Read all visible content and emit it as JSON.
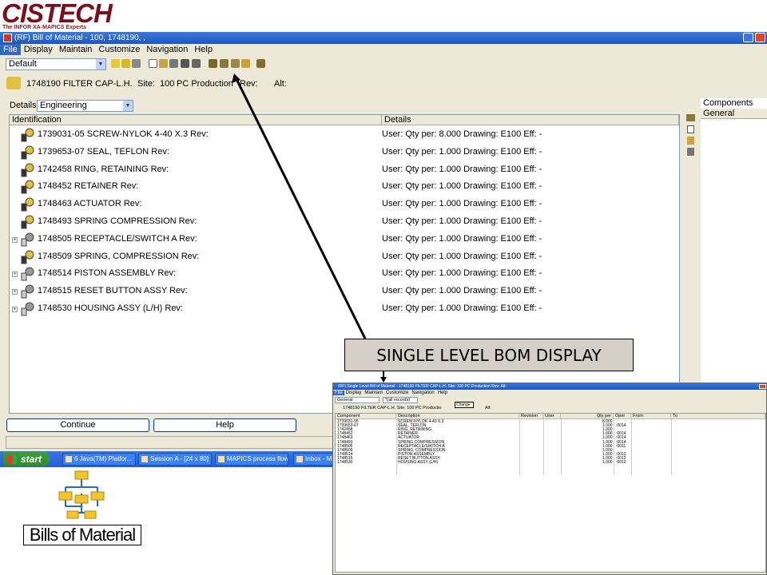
{
  "logo": {
    "text": "CISTECH",
    "tagline": "The INFOR XA-MAPICS Experts"
  },
  "window": {
    "title": "(RF) Bill of Material - 100, 1748190, ,"
  },
  "menu": [
    "File",
    "Display",
    "Maintain",
    "Customize",
    "Navigation",
    "Help"
  ],
  "toolbar": {
    "view": "Default"
  },
  "item": {
    "number": "1748190",
    "description": "FILTER CAP-L.H.",
    "site_label": "Site:",
    "site": "100",
    "site_name": "PC Production",
    "rev_label": "Rev:",
    "alt_label": "Alt:"
  },
  "details": {
    "label": "Details:",
    "value": "Engineering"
  },
  "columns": {
    "identification": "Identification",
    "details": "Details"
  },
  "rows": [
    {
      "id": "1739031-05 SCREW-NYLOK 4-40 X.3   Rev:",
      "det": "User:   Qty per: 8.000   Drawing: E100   Eff: -",
      "expand": false,
      "type": "purchased"
    },
    {
      "id": "1739653-07 SEAL, TEFLON   Rev:",
      "det": "User:   Qty per: 1.000   Drawing: E100   Eff: -",
      "expand": false,
      "type": "purchased"
    },
    {
      "id": "1742458 RING, RETAINING   Rev:",
      "det": "User:   Qty per: 1.000   Drawing: E100   Eff: -",
      "expand": false,
      "type": "purchased"
    },
    {
      "id": "1748452 RETAINER   Rev:",
      "det": "User:   Qty per: 1.000   Drawing: E100   Eff: -",
      "expand": false,
      "type": "purchased"
    },
    {
      "id": "1748463 ACTUATOR   Rev:",
      "det": "User:   Qty per: 1.000   Drawing: E100   Eff: -",
      "expand": false,
      "type": "purchased"
    },
    {
      "id": "1748493 SPRING COMPRESSION   Rev:",
      "det": "User:   Qty per: 1.000   Drawing: E100   Eff: -",
      "expand": false,
      "type": "purchased"
    },
    {
      "id": "1748505 RECEPTACLE/SWITCH A   Rev:",
      "det": "User:   Qty per: 1.000   Drawing: E100   Eff: -",
      "expand": true,
      "type": "assembly"
    },
    {
      "id": "1748509 SPRING, COMPRESSION   Rev:",
      "det": "User:   Qty per: 1.000   Drawing: E100   Eff: -",
      "expand": false,
      "type": "purchased"
    },
    {
      "id": "1748514 PISTON ASSEMBLY   Rev:",
      "det": "User:   Qty per: 1.000   Drawing: E100   Eff: -",
      "expand": true,
      "type": "assembly"
    },
    {
      "id": "1748515 RESET BUTTON ASSY   Rev:",
      "det": "User:   Qty per: 1.000   Drawing: E100   Eff: -",
      "expand": true,
      "type": "assembly"
    },
    {
      "id": "1748530 HOUSING ASSY (L/H)   Rev:",
      "det": "User:   Qty per: 1.000   Drawing: E100   Eff: -",
      "expand": true,
      "type": "assembly"
    }
  ],
  "right_panel": {
    "title": "Components",
    "tab": "General"
  },
  "buttons": {
    "continue": "Continue",
    "help": "Help"
  },
  "taskbar": {
    "start": "start",
    "tasks": [
      "6 Java(TM) Platfor...",
      "Session A - [24 x 80]",
      "MAPICS process flow ...",
      "Inbox - Mic"
    ]
  },
  "bom_logo": {
    "label": "Bills of Material"
  },
  "callout": "SINGLE LEVEL BOM DISPLAY",
  "inset": {
    "title": "(RF) Single Level Bill of Material - 1748190  FILTER CAP-L.H.   Site: 100  PC Production   Rev:   Alt:",
    "menu": [
      "File",
      "Display",
      "Maintain",
      "Customize",
      "Navigation",
      "Help"
    ],
    "view": "General",
    "filter": "*(all records)",
    "change_tip": "Change",
    "info": "1748190  FILTER CAP-L.H.    Site:   100   PC Productio",
    "info_alt": "Alt:",
    "headers": [
      "Component",
      "Description",
      "Revision",
      "User",
      "Qty per",
      "Oper",
      "From",
      "To"
    ],
    "rows": [
      [
        "1739031-05",
        "SCREW-NYLOK 4-40 X.3",
        "8.000",
        ""
      ],
      [
        "1739653-07",
        "SEAL, TEFLON",
        "1.000",
        "0014"
      ],
      [
        "1742458",
        "RING, RETAINING",
        "1.000",
        ""
      ],
      [
        "1748452",
        "RETAINER",
        "1.000",
        "0014"
      ],
      [
        "1748463",
        "ACTUATOR",
        "1.000",
        "0014"
      ],
      [
        "1748493",
        "SPRING COMPRESSION",
        "1.000",
        "0014"
      ],
      [
        "1748505",
        "RECEPTACLE/SWITCH A",
        "1.000",
        "0011"
      ],
      [
        "1748509",
        "SPRING, COMPRESSION",
        "1.000",
        ""
      ],
      [
        "1748514",
        "PISTON ASSEMBLY",
        "1.000",
        "0013"
      ],
      [
        "1748515",
        "RESET BUTTON ASSY",
        "1.000",
        "0012"
      ],
      [
        "1748530",
        "HOUSING ASSY (L/H)",
        "1.000",
        "0010"
      ]
    ]
  }
}
